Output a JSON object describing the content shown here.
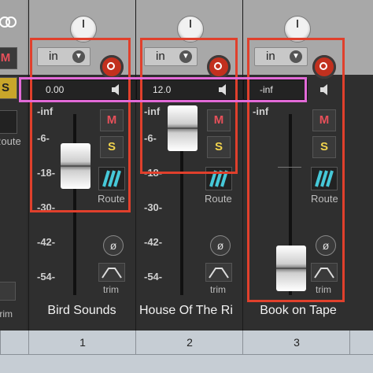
{
  "partial_channel": {
    "mute_label": "M",
    "solo_label": "S",
    "route_label": "Route",
    "trim_label": "trim"
  },
  "channels": [
    {
      "number": "1",
      "name": "Bird Sounds",
      "input_label": "in",
      "gain_value": "0.00",
      "mute_label": "M",
      "solo_label": "S",
      "route_label": "Route",
      "trim_label": "trim",
      "fader_level_db": "-18",
      "scale": [
        "-inf",
        "-6-",
        "-18-",
        "-30-",
        "-42-",
        "-54-"
      ]
    },
    {
      "number": "2",
      "name": "House Of The Ri",
      "input_label": "in",
      "gain_value": "12.0",
      "mute_label": "M",
      "solo_label": "S",
      "route_label": "Route",
      "trim_label": "trim",
      "fader_level_db": "-6",
      "scale": [
        "-inf",
        "-6-",
        "-18-",
        "-30-",
        "-42-",
        "-54-"
      ]
    },
    {
      "number": "3",
      "name": "Book on Tape",
      "input_label": "in",
      "gain_value": "-inf",
      "mute_label": "M",
      "solo_label": "S",
      "route_label": "Route",
      "trim_label": "trim",
      "fader_level_db": "-54",
      "scale": [
        "-inf"
      ]
    }
  ],
  "colors": {
    "highlight_red": "#e0402c",
    "highlight_pink": "#e26ad8",
    "mute": "#e7505a",
    "solo": "#f1d34d",
    "record": "#c2301e"
  },
  "icons": {
    "link": "link-rings-icon",
    "speaker": "speaker-icon",
    "phase": "phase-invert-icon",
    "route": "route-stripes-icon",
    "trim": "trim-envelope-icon"
  }
}
